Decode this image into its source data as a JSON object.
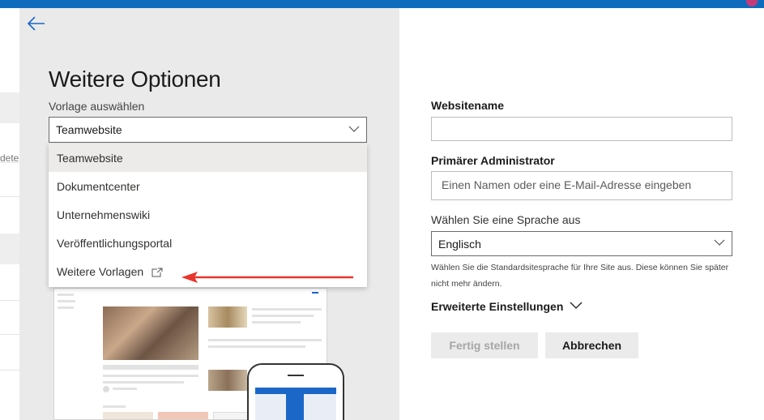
{
  "colors": {
    "accent": "#0f6cbd",
    "arrow": "#e8352b",
    "panel_bg": "#eaeaea"
  },
  "background_page": {
    "partial_text": "dete"
  },
  "panel": {
    "back_icon": "back-arrow-icon",
    "title": "Weitere Optionen",
    "template_label": "Vorlage auswählen",
    "template_selected": "Teamwebsite",
    "template_options": [
      {
        "label": "Teamwebsite",
        "selected": true
      },
      {
        "label": "Dokumentcenter"
      },
      {
        "label": "Unternehmenswiki"
      },
      {
        "label": "Veröffentlichungsportal"
      },
      {
        "label": "Weitere Vorlagen",
        "icon": "external-link-icon"
      }
    ]
  },
  "form": {
    "site_name_label": "Websitename",
    "site_name_value": "",
    "admin_label": "Primärer Administrator",
    "admin_placeholder": "Einen Namen oder eine E-Mail-Adresse eingeben",
    "language_label": "Wählen Sie eine Sprache aus",
    "language_selected": "Englisch",
    "language_help": "Wählen Sie die Standardsitesprache für Ihre Site aus. Diese können Sie später nicht mehr ändern.",
    "advanced_label": "Erweiterte Einstellungen",
    "finish_button": "Fertig stellen",
    "cancel_button": "Abbrechen"
  }
}
